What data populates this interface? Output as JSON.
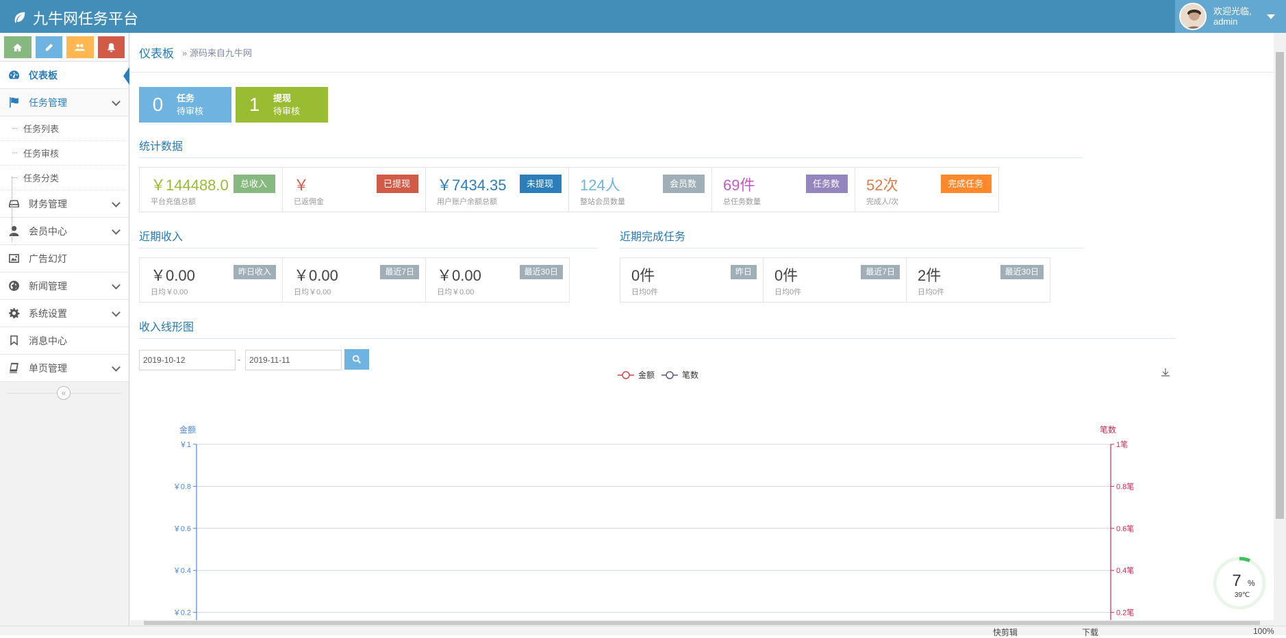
{
  "app": {
    "title": "九牛网任务平台"
  },
  "user": {
    "greeting": "欢迎光临,",
    "name": "admin"
  },
  "shortcut_colors": [
    "#87b87f",
    "#6fb3e0",
    "#ffb752",
    "#d15b47"
  ],
  "sidebar": {
    "items": [
      {
        "label": "仪表板",
        "icon": "dashboard-icon"
      },
      {
        "label": "任务管理",
        "icon": "flag-icon"
      },
      {
        "label": "财务管理",
        "icon": "hdd-icon"
      },
      {
        "label": "会员中心",
        "icon": "user-icon"
      },
      {
        "label": "广告幻灯",
        "icon": "picture-icon"
      },
      {
        "label": "新闻管理",
        "icon": "globe-icon"
      },
      {
        "label": "系统设置",
        "icon": "cog-icon"
      },
      {
        "label": "消息中心",
        "icon": "bookmark-icon"
      },
      {
        "label": "单页管理",
        "icon": "book-icon"
      }
    ],
    "sub_items": [
      "任务列表",
      "任务审核",
      "任务分类"
    ]
  },
  "breadcrumb": {
    "title": "仪表板",
    "sub": "» 源码来自九牛网"
  },
  "infoboxes": [
    {
      "num": "0",
      "title": "任务",
      "sub": "待审核",
      "color": "#6fb3e0"
    },
    {
      "num": "1",
      "title": "提现",
      "sub": "待审核",
      "color": "#9abc32"
    }
  ],
  "sections": {
    "stats": "统计数据",
    "recent_income": "近期收入",
    "recent_tasks": "近期完成任务",
    "chart": "收入线形图"
  },
  "stats": [
    {
      "value": "￥144488.0",
      "sub": "平台充值总额",
      "tag": "总收入",
      "color": "#87b87f"
    },
    {
      "value": "￥",
      "sub": "已返佣金",
      "tag": "已提现",
      "color": "#d15b47"
    },
    {
      "value": "￥7434.35",
      "sub": "用户账户余额总额",
      "tag": "未提现",
      "color": "#2b7dbc"
    },
    {
      "value": "124人",
      "sub": "整站会员数量",
      "tag": "会员数",
      "color": "#a0aeb8"
    },
    {
      "value": "69件",
      "sub": "总任务数量",
      "tag": "任务数",
      "color": "#9585bf"
    },
    {
      "value": "52次",
      "sub": "完成人/次",
      "tag": "完成任务",
      "color": "#ff892a"
    }
  ],
  "value_colors": [
    "#9abc32",
    "#d15b47",
    "#2b7dbc",
    "#6fb3e0",
    "#c25bc2",
    "#e27c4a"
  ],
  "income": [
    {
      "value": "￥0.00",
      "sub": "日均￥0.00",
      "tag": "昨日收入"
    },
    {
      "value": "￥0.00",
      "sub": "日均￥0.00",
      "tag": "最近7日"
    },
    {
      "value": "￥0.00",
      "sub": "日均￥0.00",
      "tag": "最近30日"
    }
  ],
  "tasks": [
    {
      "value": "0件",
      "sub": "日均0件",
      "tag": "昨日"
    },
    {
      "value": "0件",
      "sub": "日均0件",
      "tag": "最近7日"
    },
    {
      "value": "2件",
      "sub": "日均0件",
      "tag": "最近30日"
    }
  ],
  "date_range": {
    "from": "2019-10-12",
    "sep": "-",
    "to": "2019-11-11"
  },
  "chart_data": {
    "type": "line",
    "series": [
      {
        "name": "金额",
        "values": [],
        "color": "#d04545"
      },
      {
        "name": "笔数",
        "values": [],
        "color": "#555e75"
      }
    ],
    "ylabel_left": "金额",
    "ylabel_right": "笔数",
    "left_ticks": [
      "￥1",
      "￥0.8",
      "￥0.6",
      "￥0.4",
      "￥0.2"
    ],
    "right_ticks": [
      "1笔",
      "0.8笔",
      "0.6笔",
      "0.4笔",
      "0.2笔"
    ],
    "ylim": [
      0,
      1
    ],
    "grid": true,
    "legend": "top-center"
  },
  "gauge": {
    "percent": "7",
    "unit": "%",
    "temp": "39℃"
  },
  "statusbar": {
    "items": [
      "快剪辑",
      "下载",
      "100%"
    ]
  }
}
